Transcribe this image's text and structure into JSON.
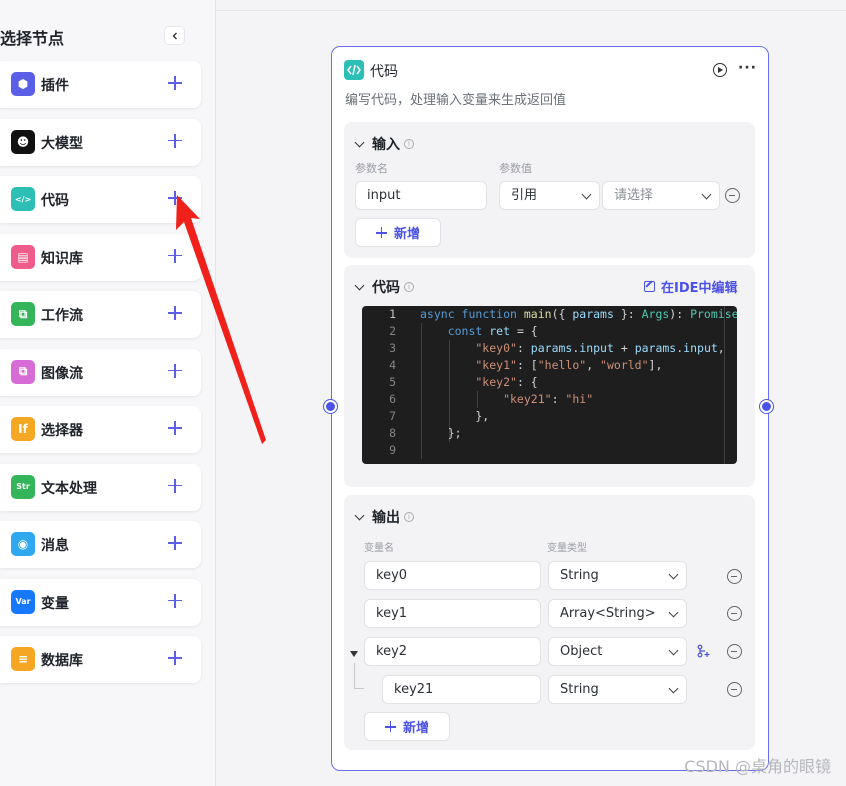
{
  "sidebar": {
    "title": "选择节点",
    "items": [
      {
        "label": "插件",
        "icon": "plugin-icon",
        "color": "#5b5fe8",
        "glyph": "⬢"
      },
      {
        "label": "大模型",
        "icon": "llm-icon",
        "color": "#111111",
        "glyph": "☻"
      },
      {
        "label": "代码",
        "icon": "code-icon",
        "color": "#2bbfb6",
        "glyph": "</>"
      },
      {
        "label": "知识库",
        "icon": "knowledge-icon",
        "color": "#ef5b8a",
        "glyph": "▤"
      },
      {
        "label": "工作流",
        "icon": "workflow-icon",
        "color": "#34b55a",
        "glyph": "⧉"
      },
      {
        "label": "图像流",
        "icon": "imageflow-icon",
        "color": "#d86cd6",
        "glyph": "⧉"
      },
      {
        "label": "选择器",
        "icon": "selector-icon",
        "color": "#f5a623",
        "glyph": "If"
      },
      {
        "label": "文本处理",
        "icon": "text-process-icon",
        "color": "#34b55a",
        "glyph": "Str"
      },
      {
        "label": "消息",
        "icon": "message-icon",
        "color": "#2fa8f0",
        "glyph": "◉"
      },
      {
        "label": "变量",
        "icon": "variable-icon",
        "color": "#1677ff",
        "glyph": "Var"
      },
      {
        "label": "数据库",
        "icon": "database-icon",
        "color": "#f5a623",
        "glyph": "≡"
      }
    ]
  },
  "node": {
    "title": "代码",
    "description": "编写代码，处理输入变量来生成返回值",
    "input": {
      "title": "输入",
      "param_name_label": "参数名",
      "param_value_label": "参数值",
      "name_value": "input",
      "ref_value": "引用",
      "select_placeholder": "请选择",
      "add_label": "新增"
    },
    "code": {
      "title": "代码",
      "ide_label": "在IDE中编辑",
      "lines": [
        {
          "n": "1",
          "tokens": [
            [
              "async ",
              "k-kw"
            ],
            [
              "function ",
              "k-kw"
            ],
            [
              "main",
              "k-fn"
            ],
            [
              "({ ",
              "k-p"
            ],
            [
              "params",
              "k-var"
            ],
            [
              " }: ",
              "k-p"
            ],
            [
              "Args",
              "k-type"
            ],
            [
              "): ",
              "k-p"
            ],
            [
              "Promise",
              "k-type"
            ]
          ]
        },
        {
          "n": "2",
          "tokens": [
            [
              "    const ",
              "k-kw"
            ],
            [
              "ret",
              "k-var"
            ],
            [
              " = {",
              "k-p"
            ]
          ]
        },
        {
          "n": "3",
          "tokens": [
            [
              "        \"key0\"",
              "k-str"
            ],
            [
              ": ",
              "k-p"
            ],
            [
              "params",
              "k-var"
            ],
            [
              ".",
              "k-p"
            ],
            [
              "input",
              "k-var"
            ],
            [
              " + ",
              "k-p"
            ],
            [
              "params",
              "k-var"
            ],
            [
              ".",
              "k-p"
            ],
            [
              "input",
              "k-var"
            ],
            [
              ",",
              "k-p"
            ]
          ]
        },
        {
          "n": "4",
          "tokens": [
            [
              "        \"key1\"",
              "k-str"
            ],
            [
              ": [",
              "k-p"
            ],
            [
              "\"hello\"",
              "k-str"
            ],
            [
              ", ",
              "k-p"
            ],
            [
              "\"world\"",
              "k-str"
            ],
            [
              "],",
              "k-p"
            ]
          ]
        },
        {
          "n": "5",
          "tokens": [
            [
              "        \"key2\"",
              "k-str"
            ],
            [
              ": {",
              "k-p"
            ]
          ]
        },
        {
          "n": "6",
          "tokens": [
            [
              "            \"key21\"",
              "k-str"
            ],
            [
              ": ",
              "k-p"
            ],
            [
              "\"hi\"",
              "k-str"
            ]
          ]
        },
        {
          "n": "7",
          "tokens": [
            [
              "        },",
              "k-p"
            ]
          ]
        },
        {
          "n": "8",
          "tokens": [
            [
              "    };",
              "k-p"
            ]
          ]
        },
        {
          "n": "9",
          "tokens": [
            [
              "",
              "k-p"
            ]
          ]
        }
      ]
    },
    "output": {
      "title": "输出",
      "var_name_label": "变量名",
      "var_type_label": "变量类型",
      "rows": [
        {
          "name": "key0",
          "type": "String"
        },
        {
          "name": "key1",
          "type": "Array<String>"
        },
        {
          "name": "key2",
          "type": "Object"
        },
        {
          "name": "key21",
          "type": "String"
        }
      ],
      "add_label": "新增"
    }
  },
  "watermark": "CSDN @桌角的眼镜",
  "colors": {
    "accent": "#4b52e8",
    "arrow": "#f0201a"
  }
}
